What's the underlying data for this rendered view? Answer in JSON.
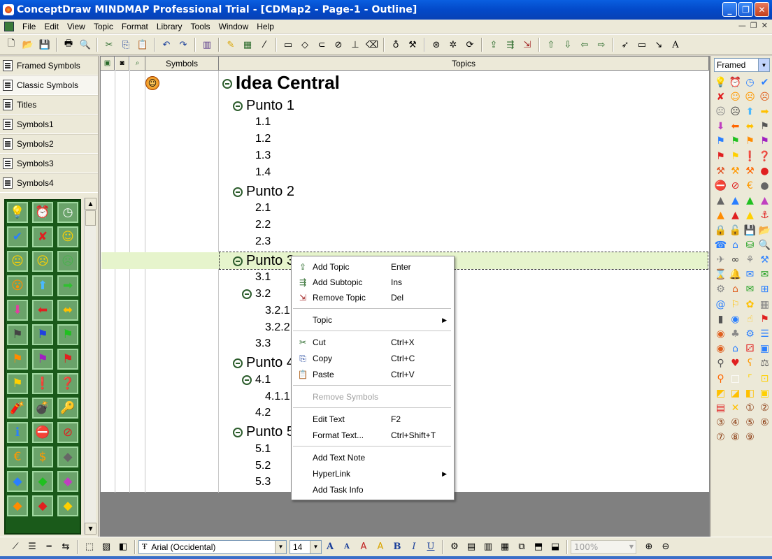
{
  "window": {
    "title": "ConceptDraw MINDMAP Professional Trial - [CDMap2 - Page-1 - Outline]",
    "buttons": [
      "_",
      "❐",
      "✕"
    ]
  },
  "menubar": {
    "items": [
      "File",
      "Edit",
      "View",
      "Topic",
      "Format",
      "Library",
      "Tools",
      "Window",
      "Help"
    ]
  },
  "library_tabs": [
    "Framed Symbols",
    "Classic Symbols",
    "Titles",
    "Symbols1",
    "Symbols2",
    "Symbols3",
    "Symbols4"
  ],
  "outline": {
    "columns": [
      "Symbols",
      "Topics"
    ],
    "topics": [
      {
        "label": "Idea Central",
        "level": 0,
        "collapsible": true
      },
      {
        "label": "Punto 1",
        "level": 1,
        "collapsible": true
      },
      {
        "label": "1.1",
        "level": 2
      },
      {
        "label": "1.2",
        "level": 2
      },
      {
        "label": "1.3",
        "level": 2
      },
      {
        "label": "1.4",
        "level": 2
      },
      {
        "label": "Punto 2",
        "level": 1,
        "collapsible": true
      },
      {
        "label": "2.1",
        "level": 2
      },
      {
        "label": "2.2",
        "level": 2
      },
      {
        "label": "2.3",
        "level": 2
      },
      {
        "label": "Punto 3",
        "level": 1,
        "collapsible": true,
        "selected": true
      },
      {
        "label": "3.1",
        "level": 2
      },
      {
        "label": "3.2",
        "level": 2,
        "collapsible": true
      },
      {
        "label": "3.2.1",
        "level": 3
      },
      {
        "label": "3.2.2",
        "level": 3
      },
      {
        "label": "3.3",
        "level": 2
      },
      {
        "label": "Punto 4",
        "level": 1,
        "collapsible": true
      },
      {
        "label": "4.1",
        "level": 2,
        "collapsible": true
      },
      {
        "label": "4.1.1",
        "level": 3
      },
      {
        "label": "4.2",
        "level": 2
      },
      {
        "label": "Punto 5",
        "level": 1,
        "collapsible": true
      },
      {
        "label": "5.1",
        "level": 2
      },
      {
        "label": "5.2",
        "level": 2
      },
      {
        "label": "5.3",
        "level": 2
      }
    ]
  },
  "context_menu": {
    "items": [
      {
        "label": "Add Topic",
        "shortcut": "Enter",
        "icon": "add-topic-icon"
      },
      {
        "label": "Add Subtopic",
        "shortcut": "Ins",
        "icon": "add-subtopic-icon"
      },
      {
        "label": "Remove Topic",
        "shortcut": "Del",
        "icon": "remove-topic-icon"
      },
      {
        "label": "Topic",
        "shortcut": "",
        "submenu": true
      },
      {
        "label": "Cut",
        "shortcut": "Ctrl+X",
        "icon": "cut-icon"
      },
      {
        "label": "Copy",
        "shortcut": "Ctrl+C",
        "icon": "copy-icon"
      },
      {
        "label": "Paste",
        "shortcut": "Ctrl+V",
        "icon": "paste-icon"
      },
      {
        "label": "Remove Symbols",
        "shortcut": "",
        "disabled": true
      },
      {
        "label": "Edit Text",
        "shortcut": "F2"
      },
      {
        "label": "Format Text...",
        "shortcut": "Ctrl+Shift+T"
      },
      {
        "label": "Add Text Note",
        "shortcut": ""
      },
      {
        "label": "HyperLink",
        "shortcut": "",
        "submenu": true
      },
      {
        "label": "Add Task Info",
        "shortcut": ""
      }
    ]
  },
  "right_panel": {
    "library_select": "Framed"
  },
  "format_bar": {
    "font": "Arial (Occidental)",
    "size": "14",
    "zoom": "100%",
    "style_buttons": [
      "B",
      "I",
      "U"
    ]
  },
  "colors": {
    "titlebar": "#0349c9",
    "selected_row": "#e6f4cc",
    "symbol_panel": "#1a5a1a"
  }
}
